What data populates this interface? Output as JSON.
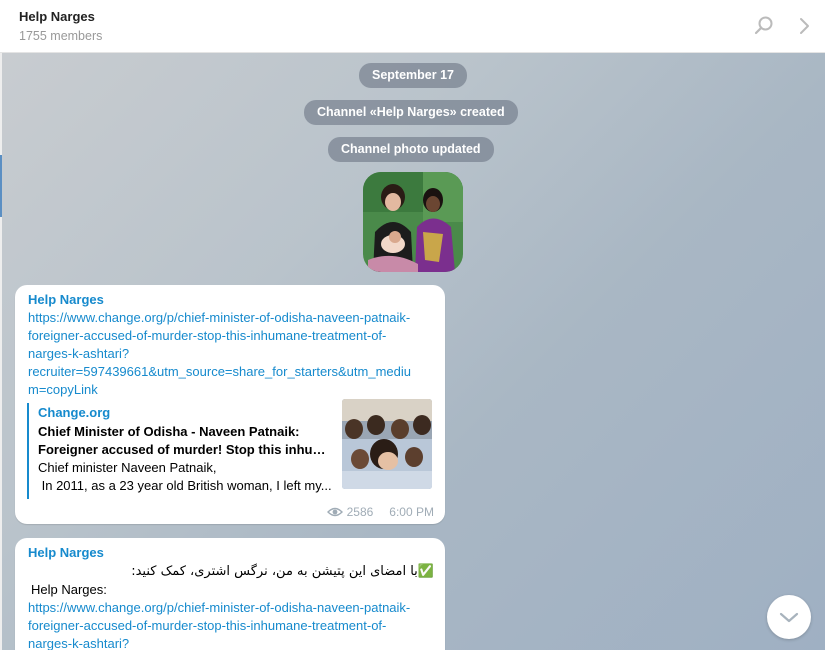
{
  "header": {
    "title": "Help Narges",
    "subtitle": "1755 members"
  },
  "service": {
    "date": "September 17",
    "created": "Channel «Help Narges» created",
    "photo_updated": "Channel photo updated"
  },
  "messages": [
    {
      "sender": "Help Narges",
      "link_lines": [
        "https://www.change.org/p/chief-minister-of-odisha-naveen-patnaik-",
        "foreigner-accused-of-murder-stop-this-inhumane-treatment-of-",
        "narges-k-ashtari?",
        "recruiter=597439661&utm_source=share_for_starters&utm_mediu",
        "m=copyLink"
      ],
      "preview": {
        "site": "Change.org",
        "title_lines": [
          "Chief Minister of Odisha - Naveen Patnaik:",
          "Foreigner accused of murder! Stop this inhum..."
        ],
        "desc_lines": [
          "Chief minister Naveen Patnaik,",
          " In 2011, as a 23 year old British woman, I left my..."
        ]
      },
      "views": "2586",
      "time": "6:00 PM"
    },
    {
      "sender": "Help Narges",
      "persian": "✅با امضای این پتیشن به من، نرگس اشتری، کمک کنید:",
      "label": "Help Narges:",
      "link_lines": [
        "https://www.change.org/p/chief-minister-of-odisha-naveen-patnaik-",
        "foreigner-accused-of-murder-stop-this-inhumane-treatment-of-",
        "narges-k-ashtari?"
      ]
    }
  ],
  "colors": {
    "accent": "#168acd",
    "header_bg": "#ffffff",
    "pill_bg": "#6b7685"
  },
  "icons": {
    "search": "search-icon",
    "chevron": "chevron-right-icon",
    "eye": "eye-icon",
    "scroll_down": "chevron-down-icon"
  }
}
